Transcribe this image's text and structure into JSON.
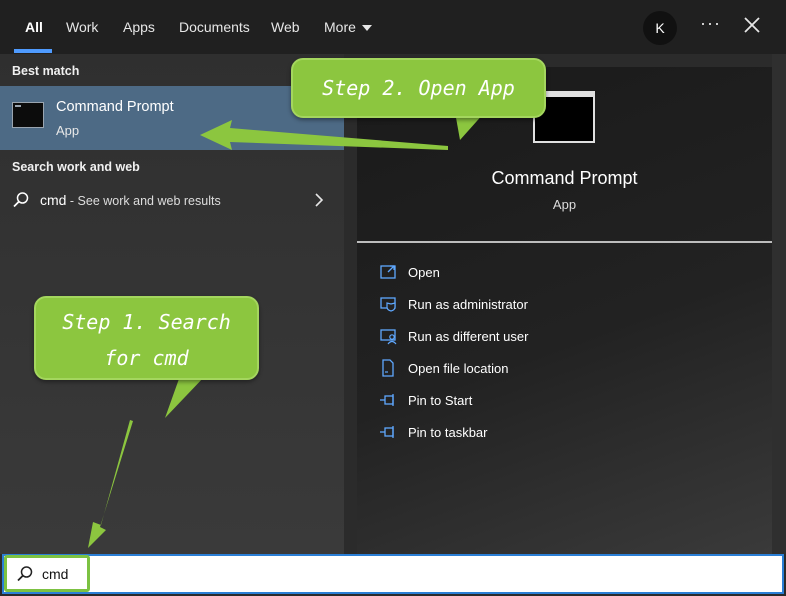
{
  "tabs": [
    {
      "label": "All",
      "active": true
    },
    {
      "label": "Work"
    },
    {
      "label": "Apps"
    },
    {
      "label": "Documents"
    },
    {
      "label": "Web"
    },
    {
      "label": "More"
    }
  ],
  "header": {
    "avatar_initial": "K",
    "more_options": "···",
    "accent_color": "#4f9bff"
  },
  "left": {
    "best_match_label": "Best match",
    "best_match": {
      "title": "Command Prompt",
      "subtitle": "App",
      "icon": "command-prompt-icon"
    },
    "search_web_label": "Search work and web",
    "web_result": {
      "query": "cmd",
      "suffix": " - See work and web results"
    }
  },
  "right": {
    "title": "Command Prompt",
    "subtitle": "App",
    "actions": [
      {
        "label": "Open",
        "icon": "open-icon"
      },
      {
        "label": "Run as administrator",
        "icon": "shield-icon"
      },
      {
        "label": "Run as different user",
        "icon": "user-icon"
      },
      {
        "label": "Open file location",
        "icon": "file-location-icon"
      },
      {
        "label": "Pin to Start",
        "icon": "pin-icon"
      },
      {
        "label": "Pin to taskbar",
        "icon": "pin-icon"
      }
    ]
  },
  "search": {
    "value": "cmd"
  },
  "callouts": {
    "step1_line1": "Step 1. Search",
    "step1_line2": "for cmd",
    "step2": "Step 2. Open App",
    "color": "#8cc63f"
  }
}
